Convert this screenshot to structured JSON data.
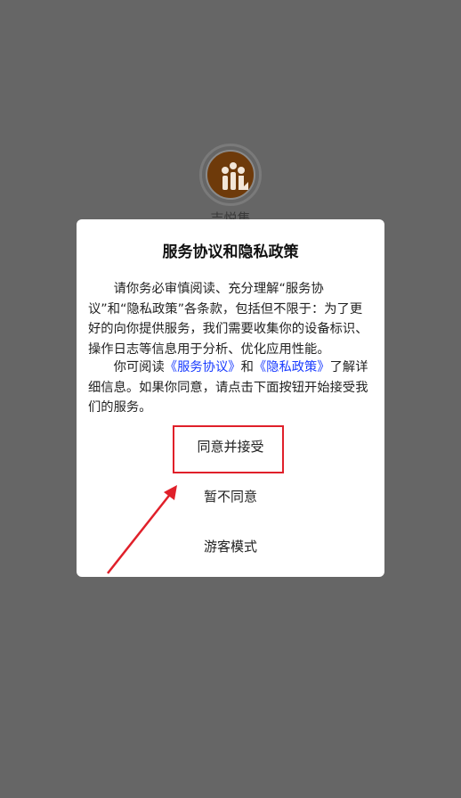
{
  "splash": {
    "app_name": "吉悦集"
  },
  "dialog": {
    "title": "服务协议和隐私政策",
    "para1": "请你务必审慎阅读、充分理解“服务协议”和“隐私政策”各条款，包括但不限于：为了更好的向你提供服务，我们需要收集你的设备标识、操作日志等信息用于分析、优化应用性能。",
    "para2_prefix": "你可阅读",
    "service_link": "《服务协议》",
    "and": "和",
    "privacy_link": "《隐私政策》",
    "para2_suffix": "了解详细信息。如果你同意，请点击下面按钮开始接受我们的服务。",
    "agree_button": "同意并接受",
    "decline_button": "暂不同意",
    "guest_button": "游客模式"
  },
  "colors": {
    "overlay": "#666666",
    "link": "#1a3cff",
    "annotation": "#e0202a"
  }
}
